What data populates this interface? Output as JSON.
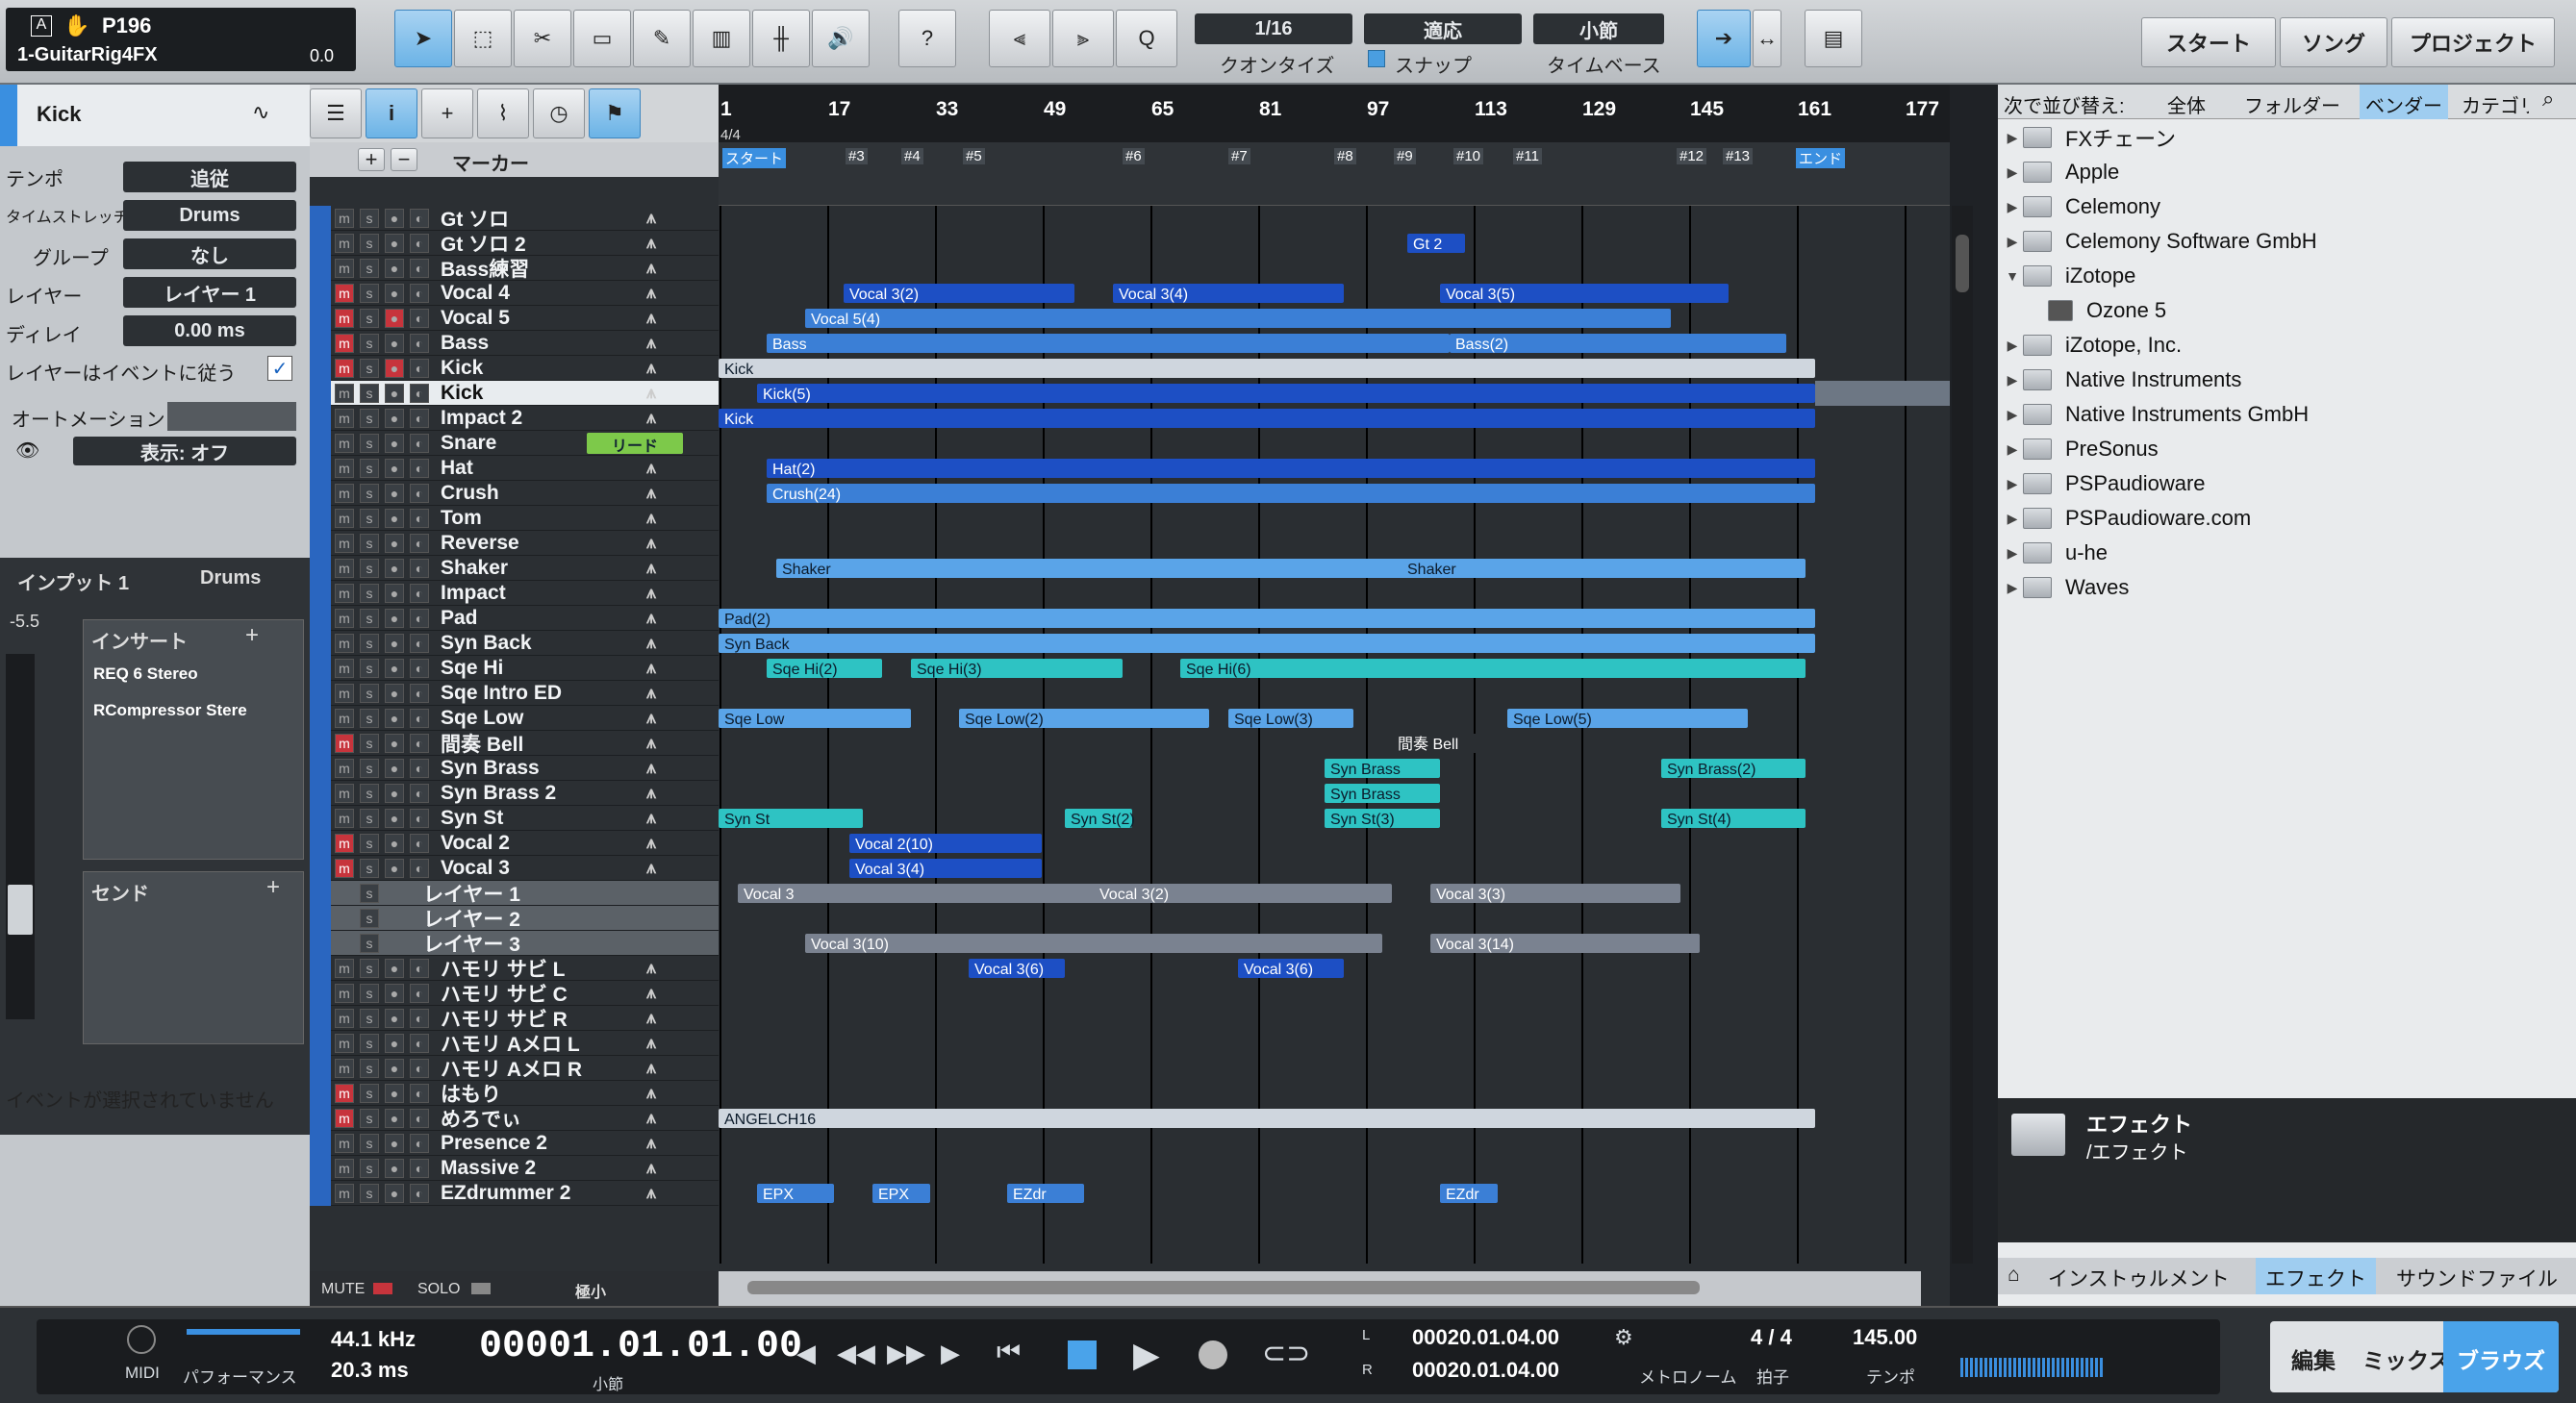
{
  "top": {
    "song": "P196",
    "channel": "1-GuitarRig4FX",
    "gain": "0.0",
    "quant_label": "クオンタイズ",
    "quant": "1/16",
    "snap_label": "スナップ",
    "snap": "適応",
    "tb_label": "タイムベース",
    "tb": "小節",
    "start": "スタート",
    "song_btn": "ソング",
    "project": "プロジェクト",
    "help": "?"
  },
  "inspector": {
    "track": "Kick",
    "rows": [
      {
        "label": "テンポ",
        "value": "追従"
      },
      {
        "label": "タイムストレッチ",
        "value": "Drums"
      },
      {
        "label": "グループ",
        "value": "なし"
      },
      {
        "label": "レイヤー",
        "value": "レイヤー 1"
      },
      {
        "label": "ディレイ",
        "value": "0.00 ms"
      }
    ],
    "follow": "レイヤーはイベントに従う",
    "automation": "オートメーション",
    "display": "表示: オフ",
    "input": "インプット 1",
    "input_val": "Drums",
    "pan": "-5.5",
    "insert": "インサート",
    "plug1": "REQ 6 Stereo",
    "plug2": "RCompressor Stere",
    "send": "センド",
    "noevent": "イベントが選択されていません"
  },
  "marker_label": "マーカー",
  "ruler": [
    "1",
    "17",
    "33",
    "49",
    "65",
    "81",
    "97",
    "113",
    "129",
    "145",
    "161",
    "177"
  ],
  "timesig": "4/4",
  "markers": [
    "スタート",
    "#3",
    "#4",
    "#5",
    "#6",
    "#7",
    "#8",
    "#9",
    "#10",
    "#11",
    "#12",
    "#13",
    "エンド"
  ],
  "tracks": [
    "Gt ソロ",
    "Gt ソロ 2",
    "Bass練習",
    "Vocal 4",
    "Vocal 5",
    "Bass",
    "Kick",
    "Kick",
    "Impact 2",
    "Snare",
    "Hat",
    "Crush",
    "Tom",
    "Reverse",
    "Shaker",
    "Impact",
    "Pad",
    "Syn Back",
    "Sqe Hi",
    "Sqe Intro ED",
    "Sqe Low",
    "間奏 Bell",
    "Syn Brass",
    "Syn Brass 2",
    "Syn St",
    "Vocal 2",
    "Vocal 3",
    "レイヤー 1",
    "レイヤー 2",
    "レイヤー 3",
    "ハモリ サビ L",
    "ハモリ サビ C",
    "ハモリ サビ R",
    "ハモリ Aメロ L",
    "ハモリ Aメロ R",
    "はもり",
    "めろでぃ",
    "Presence 2",
    "Massive 2",
    "EZdrummer 2"
  ],
  "snare_tag": "リード",
  "clips": [
    "Gt 2",
    "Vocal 3(2)",
    "Vocal 3(4)",
    "Vocal 3(5)",
    "Vocal 5(4)",
    "Bass",
    "Bass(2)",
    "Kick",
    "Kick(5)",
    "Kick",
    "Hat(2)",
    "Crush(24)",
    "Shaker",
    "Shaker",
    "Pad(2)",
    "Syn Back",
    "Sqe Hi(2)",
    "Sqe Hi(3)",
    "Sqe Hi(6)",
    "Sqe Low",
    "Sqe Low(2)",
    "Sqe Low(3)",
    "Sqe Low(5)",
    "間奏 Bell",
    "Syn Brass",
    "Syn Brass",
    "Syn Brass(2)",
    "Syn St",
    "Syn St(2)",
    "Syn St(3)",
    "Syn St(4)",
    "Vocal 2(10)",
    "Vocal 3(4)",
    "Vocal 3",
    "Vocal 3(2)",
    "Vocal 3(3)",
    "Vocal 3(10)",
    "Vocal 3(14)",
    "Vocal 3(6)",
    "ANGELCH16",
    "EPX",
    "EZdr"
  ],
  "browser": {
    "sort": "次で並び替え:",
    "tabs": [
      "全体",
      "フォルダー",
      "ベンダー",
      "カテゴリー"
    ],
    "items": [
      "FXチェーン",
      "Apple",
      "Celemony",
      "Celemony Software GmbH",
      "iZotope",
      "Ozone 5",
      "iZotope, Inc.",
      "Native Instruments",
      "Native Instruments GmbH",
      "PreSonus",
      "PSPaudioware",
      "PSPaudioware.com",
      "u-he",
      "Waves"
    ],
    "info_title": "エフェクト",
    "info_path": "/エフェクト",
    "btabs": [
      "インストゥルメント",
      "エフェクト",
      "サウンドファイル"
    ]
  },
  "bottom": {
    "mute": "MUTE",
    "solo": "SOLO",
    "size": "極小"
  },
  "transport": {
    "midi": "MIDI",
    "perf": "パフォーマンス",
    "rate": "44.1 kHz",
    "lat": "20.3 ms",
    "time": "00001.01.01.00",
    "unit": "小節",
    "l": "00020.01.04.00",
    "r": "00020.01.04.00",
    "metro": "メトロノーム",
    "sig": "4 / 4",
    "sig_label": "拍子",
    "tempo": "145.00",
    "tempo_label": "テンポ",
    "edit": "編集",
    "mix": "ミックス",
    "browse": "ブラウズ"
  }
}
